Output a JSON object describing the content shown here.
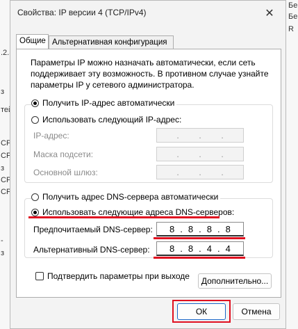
{
  "background": {
    "left_fragments": [
      ".2.5C",
      "з",
      "тей",
      "CP",
      "CP",
      "CP",
      "з",
      "CP",
      "-",
      "з"
    ],
    "right_fragments": [
      "Бе",
      "Бе",
      "R"
    ]
  },
  "dialog": {
    "title": "Свойства: IP версии 4 (TCP/IPv4)",
    "close_label": "✕",
    "tabs": [
      {
        "label": "Общие",
        "active": true
      },
      {
        "label": "Альтернативная конфигурация",
        "active": false
      }
    ],
    "info_text": "Параметры IP можно назначать автоматически, если сеть поддерживает эту возможность. В противном случае узнайте параметры IP у сетевого администратора.",
    "ip": {
      "auto_label": "Получить IP-адрес автоматически",
      "auto_checked": true,
      "manual_label": "Использовать следующий IP-адрес:",
      "manual_checked": false,
      "fields": [
        {
          "label": "IP-адрес:",
          "octets": [
            "",
            "",
            "",
            ""
          ]
        },
        {
          "label": "Маска подсети:",
          "octets": [
            "",
            "",
            "",
            ""
          ]
        },
        {
          "label": "Основной шлюз:",
          "octets": [
            "",
            "",
            "",
            ""
          ]
        }
      ]
    },
    "dns": {
      "auto_label": "Получить адрес DNS-сервера автоматически",
      "auto_checked": false,
      "manual_label": "Использовать следующие адреса DNS-серверов:",
      "manual_checked": true,
      "preferred_label": "Предпочитаемый DNS-сервер:",
      "preferred_octets": [
        "8",
        "8",
        "8",
        "8"
      ],
      "alternate_label": "Альтернативный DNS-сервер:",
      "alternate_octets": [
        "8",
        "8",
        "4",
        "4"
      ]
    },
    "validate_label": "Подтвердить параметры при выходе",
    "validate_checked": false,
    "advanced_label": "Дополнительно...",
    "ok_label": "ОК",
    "cancel_label": "Отмена"
  },
  "colors": {
    "highlight": "#e01020",
    "accent": "#1a66c9"
  }
}
